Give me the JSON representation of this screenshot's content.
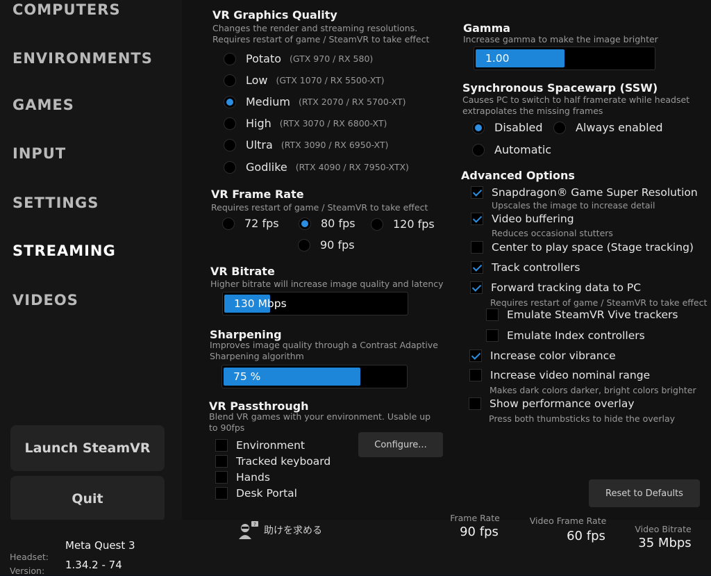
{
  "sidebar": {
    "nav": [
      "COMPUTERS",
      "ENVIRONMENTS",
      "GAMES",
      "INPUT",
      "SETTINGS",
      "STREAMING",
      "VIDEOS"
    ],
    "active": "STREAMING",
    "launch_label": "Launch SteamVR",
    "quit_label": "Quit"
  },
  "graphics": {
    "title": "VR Graphics Quality",
    "desc1": "Changes the render and streaming resolutions.",
    "desc2": "Requires restart of game / SteamVR to take effect",
    "options": [
      {
        "label": "Potato",
        "hint": "(GTX 970 / RX 580)"
      },
      {
        "label": "Low",
        "hint": "(GTX 1070 / RX 5500-XT)"
      },
      {
        "label": "Medium",
        "hint": "(RTX 2070 / RX 5700-XT)"
      },
      {
        "label": "High",
        "hint": "(RTX 3070 / RX 6800-XT)"
      },
      {
        "label": "Ultra",
        "hint": "(RTX 3090 / RX 6950-XT)"
      },
      {
        "label": "Godlike",
        "hint": "(RTX 4090 / RX 7950-XTX)"
      }
    ],
    "selected": "Medium"
  },
  "framerate": {
    "title": "VR Frame Rate",
    "desc": "Requires restart of game / SteamVR to take effect",
    "options": [
      "72 fps",
      "80 fps",
      "120 fps",
      "90 fps"
    ],
    "selected": "80 fps"
  },
  "bitrate": {
    "title": "VR Bitrate",
    "desc": "Higher bitrate will increase image quality and latency",
    "value": "130 Mbps",
    "fill_fraction": 0.25
  },
  "sharpening": {
    "title": "Sharpening",
    "desc1": "Improves image quality through a Contrast Adaptive",
    "desc2": "Sharpening algorithm",
    "value": "75 %",
    "fill_fraction": 0.75
  },
  "passthrough": {
    "title": "VR Passthrough",
    "desc1": "Blend VR games with your environment. Usable up",
    "desc2": "to 90fps",
    "options": [
      "Environment",
      "Tracked keyboard",
      "Hands",
      "Desk Portal"
    ],
    "configure_label": "Configure..."
  },
  "gamma": {
    "title": "Gamma",
    "desc": "Increase gamma to make the image brighter",
    "value": "1.00",
    "fill_fraction": 0.5
  },
  "ssw": {
    "title": "Synchronous Spacewarp (SSW)",
    "desc1": "Causes PC to switch to half framerate while headset",
    "desc2": "extrapolates the missing frames",
    "options": [
      "Disabled",
      "Always enabled",
      "Automatic"
    ],
    "selected": "Disabled"
  },
  "advanced": {
    "title": "Advanced Options",
    "items": [
      {
        "label": "Snapdragon® Game Super Resolution",
        "sub": "Upscales the image to increase detail",
        "checked": true
      },
      {
        "label": "Video buffering",
        "sub": "Reduces occasional stutters",
        "checked": true
      },
      {
        "label": "Center to play space (Stage tracking)",
        "sub": "",
        "checked": false
      },
      {
        "label": "Track controllers",
        "sub": "",
        "checked": true
      },
      {
        "label": "Forward tracking data to PC",
        "sub": "Requires restart of game / SteamVR to take effect",
        "checked": true
      },
      {
        "label": "Emulate SteamVR Vive trackers",
        "sub": "",
        "checked": false
      },
      {
        "label": "Emulate Index controllers",
        "sub": "",
        "checked": false
      },
      {
        "label": "Increase color vibrance",
        "sub": "",
        "checked": true
      },
      {
        "label": "Increase video nominal range",
        "sub": "Makes dark colors darker, bright colors brighter",
        "checked": false
      },
      {
        "label": "Show performance overlay",
        "sub": "Press both thumbsticks to hide the overlay",
        "checked": false
      }
    ],
    "reset_label": "Reset to Defaults"
  },
  "footer": {
    "headset_label": "Headset:",
    "headset_value": "Meta Quest 3",
    "version_label": "Version:",
    "version_value": "1.34.2 - 74",
    "help_label": "助けを求める",
    "stats": [
      {
        "label": "Frame Rate",
        "value": "90 fps"
      },
      {
        "label": "Video Frame Rate",
        "value": "60 fps"
      },
      {
        "label": "Video Bitrate",
        "value": "35 Mbps"
      }
    ]
  },
  "colors": {
    "accent": "#1d86d8",
    "panel": "#121212",
    "sidebar": "#161616"
  },
  "icons": {
    "help": "support-agent-icon"
  }
}
